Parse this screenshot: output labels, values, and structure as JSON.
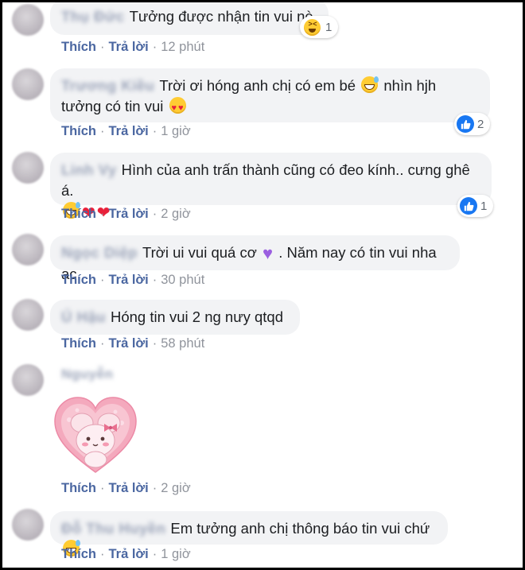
{
  "actions": {
    "like": "Thích",
    "reply": "Trả lời",
    "sep": "·"
  },
  "comments": [
    {
      "author": "Thụ Đức",
      "text": "Tưởng được nhận tin vui nè",
      "emoji_after": "squinting-laughing-emoji",
      "time": "12 phút",
      "reactions": {
        "type": "haha",
        "count": "1"
      }
    },
    {
      "author": "Trương Kiều",
      "text_1": "Trời ơi hóng anh chị có em bé",
      "emoji_1": "grinning-sweat-emoji",
      "text_2": "nhìn hjh tưởng có tin vui",
      "emoji_2": "heart-eyes-emoji",
      "time": "1 giờ",
      "reactions": {
        "type": "like",
        "count": "2"
      }
    },
    {
      "author": "Linh Vy",
      "text": "Hình của anh trấn thành cũng có đeo kính.. cưng ghê á.",
      "emojis": [
        "grinning-sweat-emoji",
        "sparkling-heart-emoji",
        "sparkling-heart-emoji"
      ],
      "time": "2 giờ",
      "reactions": {
        "type": "like",
        "count": "1"
      }
    },
    {
      "author": "Ngọc Diệp",
      "text_1": "Trời ui vui quá cơ",
      "emoji_1": "purple-heart-emoji",
      "text_2": ". Năm nay có tin vui nha ac",
      "time": "30 phút"
    },
    {
      "author": "Ú Hậu",
      "text": "Hóng tin vui 2 ng nưy qtqd",
      "time": "58 phút"
    },
    {
      "author": "Nguyễn",
      "sticker": "pink-bunny-heart-sticker",
      "time": "2 giờ"
    },
    {
      "author": "Đỗ Thu Huyền",
      "text": "Em tưởng anh chị thông báo tin vui chứ",
      "emoji_after": "grinning-sweat-emoji",
      "time": "1 giờ"
    }
  ],
  "colors": {
    "bubble": "#f2f3f5",
    "link": "#4b67a1",
    "meta": "#90949c",
    "like": "#1877f2"
  }
}
